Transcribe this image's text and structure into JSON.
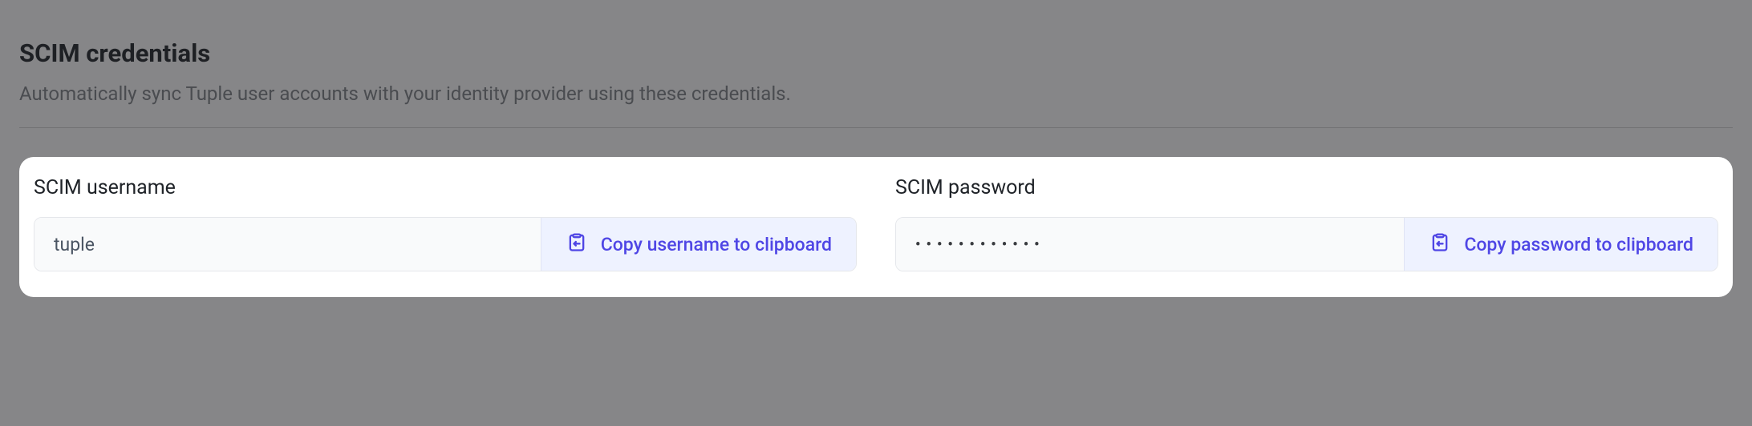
{
  "section": {
    "title": "SCIM credentials",
    "subtitle": "Automatically sync Tuple user accounts with your identity provider using these credentials."
  },
  "fields": {
    "username": {
      "label": "SCIM username",
      "value": "tuple",
      "copy_label": "Copy username to clipboard"
    },
    "password": {
      "label": "SCIM password",
      "value_masked": "••••••••••••",
      "copy_label": "Copy password to clipboard"
    }
  },
  "colors": {
    "accent": "#4f46e5",
    "button_bg": "#eef2ff",
    "card_bg": "#ffffff",
    "page_bg": "#868688"
  }
}
